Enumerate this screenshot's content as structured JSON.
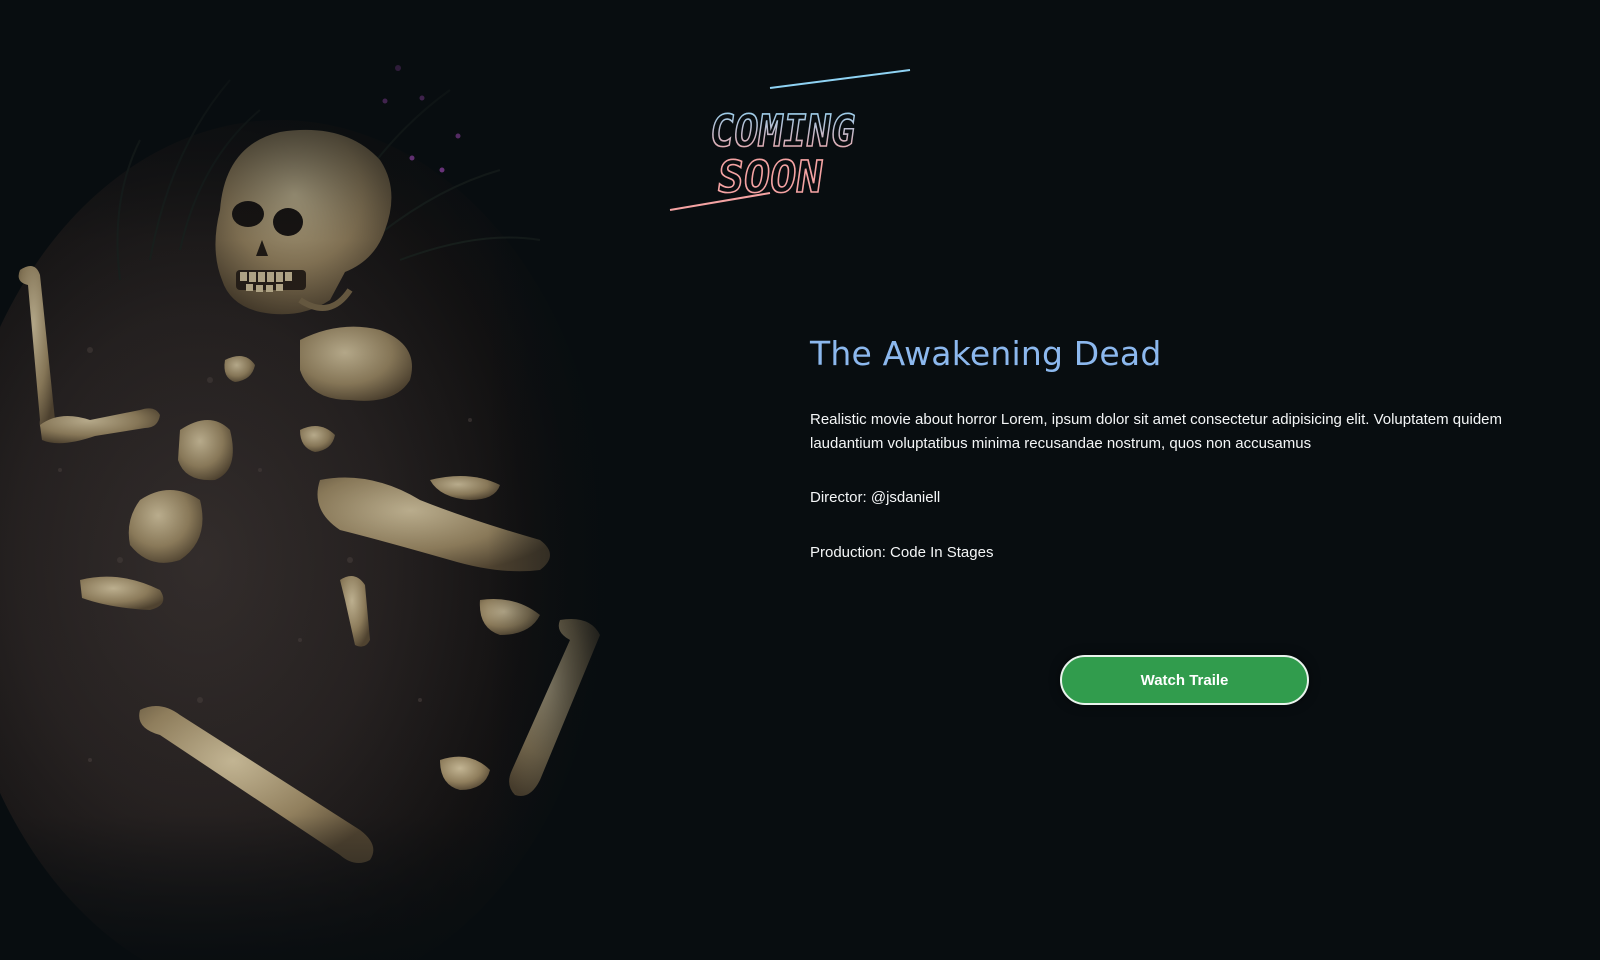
{
  "logo": {
    "line1": "COMING",
    "line2": "SOON"
  },
  "movie": {
    "title": "The Awakening Dead",
    "description": "Realistic movie about horror Lorem, ipsum dolor sit amet consectetur adipisicing elit. Voluptatem quidem laudantium voluptatibus minima recusandae nostrum, quos non accusamus",
    "director": "Director: @jsdaniell",
    "production": "Production: Code In Stages"
  },
  "actions": {
    "watch_label": "Watch Traile"
  },
  "colors": {
    "background": "#080d10",
    "title": "#8cb8ee",
    "button": "#319c4d",
    "logo_blue": "#8fd3f4",
    "logo_pink": "#f5a3a3"
  }
}
